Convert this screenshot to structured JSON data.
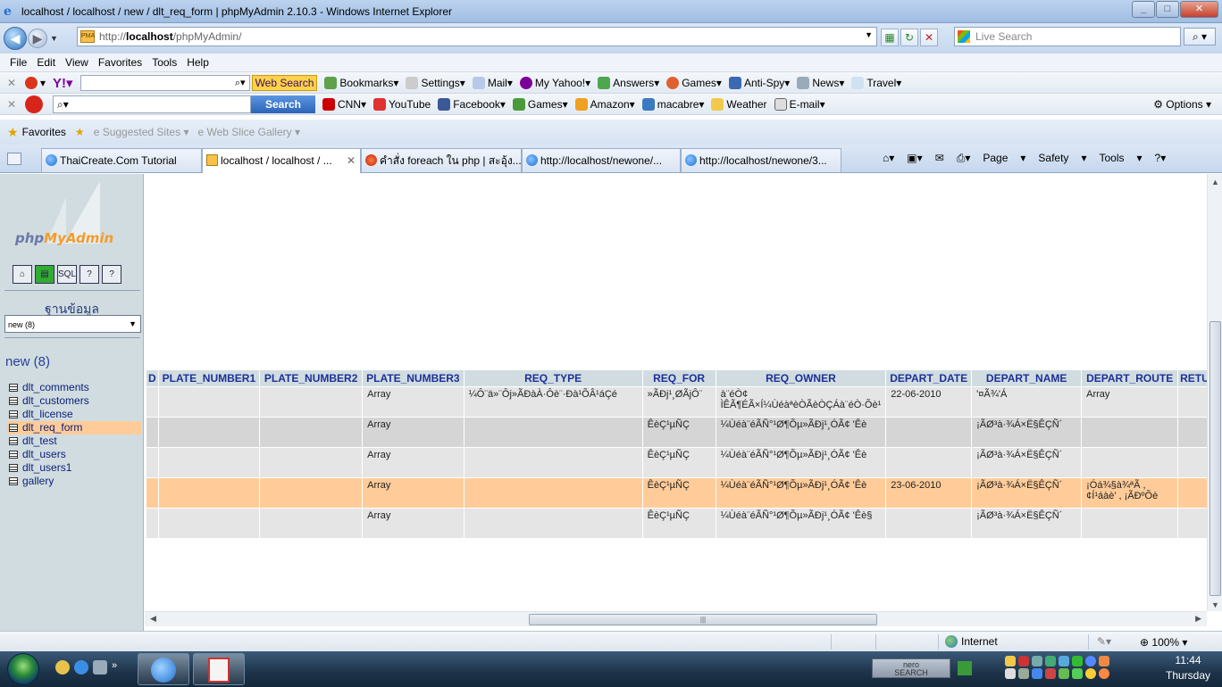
{
  "window": {
    "title": "localhost / localhost / new / dlt_req_form | phpMyAdmin 2.10.3 - Windows Internet Explorer"
  },
  "address_bar": {
    "url_prefix": "http://",
    "url_host": "localhost",
    "url_path": "/phpMyAdmin/",
    "search_placeholder": "Live Search"
  },
  "menu": [
    "File",
    "Edit",
    "View",
    "Favorites",
    "Tools",
    "Help"
  ],
  "yahoo_toolbar": {
    "web_search": "Web Search",
    "items": [
      "Bookmarks",
      "Settings",
      "Mail",
      "My Yahoo!",
      "Answers",
      "Games",
      "Anti-Spy",
      "News",
      "Travel"
    ]
  },
  "ask_toolbar": {
    "search_button": "Search",
    "items": [
      "CNN",
      "YouTube",
      "Facebook",
      "Games",
      "Amazon",
      "macabre",
      "Weather",
      "E-mail"
    ],
    "options": "Options"
  },
  "favorites_bar": {
    "favorites": "Favorites",
    "items": [
      "Suggested Sites",
      "Web Slice Gallery"
    ]
  },
  "tabs": [
    {
      "label": "ThaiCreate.Com Tutorial"
    },
    {
      "label": "localhost / localhost / ...",
      "active": true
    },
    {
      "label": "คำสั่ง foreach ใน php | สะอุ้ง..."
    },
    {
      "label": "http://localhost/newone/..."
    },
    {
      "label": "http://localhost/newone/3..."
    }
  ],
  "command_bar": [
    "Page",
    "Safety",
    "Tools"
  ],
  "sidebar": {
    "logo_php": "php",
    "logo_my": "MyAdmin",
    "db_label": "ฐานข้อมูล",
    "db_select": "new (8)",
    "db_title": "new (8)",
    "tables": [
      "dlt_comments",
      "dlt_customers",
      "dlt_license",
      "dlt_req_form",
      "dlt_test",
      "dlt_users",
      "dlt_users1",
      "gallery"
    ],
    "selected_table": "dlt_req_form"
  },
  "grid": {
    "columns": [
      "D",
      "PLATE_NUMBER1",
      "PLATE_NUMBER2",
      "PLATE_NUMBER3",
      "REQ_TYPE",
      "REQ_FOR",
      "REQ_OWNER",
      "DEPART_DATE",
      "DEPART_NAME",
      "DEPART_ROUTE",
      "RETUI"
    ],
    "rows": [
      [
        "",
        "",
        "",
        "Array",
        "¼Ô¨ä»¨Ôj»ÃÐàÀ·Ôè¨·Ðà¹ÕÂ¹áÇé",
        "»ÃÐj¹¸ØÃjÔ¨",
        "à¨éÒ¢ ÌÊÃ¶ÉÃ×Í¼ÙéàªèÒÃèÒÇÁà¨éÒ·Õè¹",
        "22-06-2010",
        "'¤Ã¾'Á",
        "Array",
        ""
      ],
      [
        "",
        "",
        "",
        "Array",
        "",
        "ÊèÇ¹µÑÇ",
        "¼Ùéà¨éÃÑ°¹Ø¶Õµ»ÃÐj¹¸ÓÃ¢ 'Êè",
        "",
        "¡ÃØ³à·¾Á×Ë§ÊÇÑ´",
        "",
        ""
      ],
      [
        "",
        "",
        "",
        "Array",
        "",
        "ÊèÇ¹µÑÇ",
        "¼Ùéà¨éÃÑ°¹Ø¶Õµ»ÃÐj¹¸ÓÃ¢ 'Êè",
        "",
        "¡ÃØ³à·¾Á×Ë§ÊÇÑ´",
        "",
        ""
      ],
      [
        "",
        "",
        "",
        "Array",
        "",
        "ÊèÇ¹µÑÇ",
        "¼Ùéà¨éÃÑ°¹Ø¶Õµ»ÃÐj¹¸ÓÃ¢ 'Êè",
        "23-06-2010",
        "¡ÃØ³à·¾Á×Ë§ÊÇÑ´",
        "¡Óá¾§à¾ªÃ , ¢Í¹áàè' , ¡ÃÐºÕè",
        ""
      ],
      [
        "",
        "",
        "",
        "Array",
        "",
        "ÊèÇ¹µÑÇ",
        "¼Ùéà¨éÃÑ°¹Ø¶Õµ»ÃÐj¹¸ÓÃ¢ 'Êè§",
        "",
        "¡ÃØ³à·¾Á×Ë§ÊÇÑ´",
        "",
        ""
      ]
    ],
    "highlighted_row": 3
  },
  "status_bar": {
    "zone": "Internet",
    "zoom": "100%"
  },
  "taskbar": {
    "time": "11:44",
    "day": "Thursday",
    "tray_label": "nero"
  }
}
